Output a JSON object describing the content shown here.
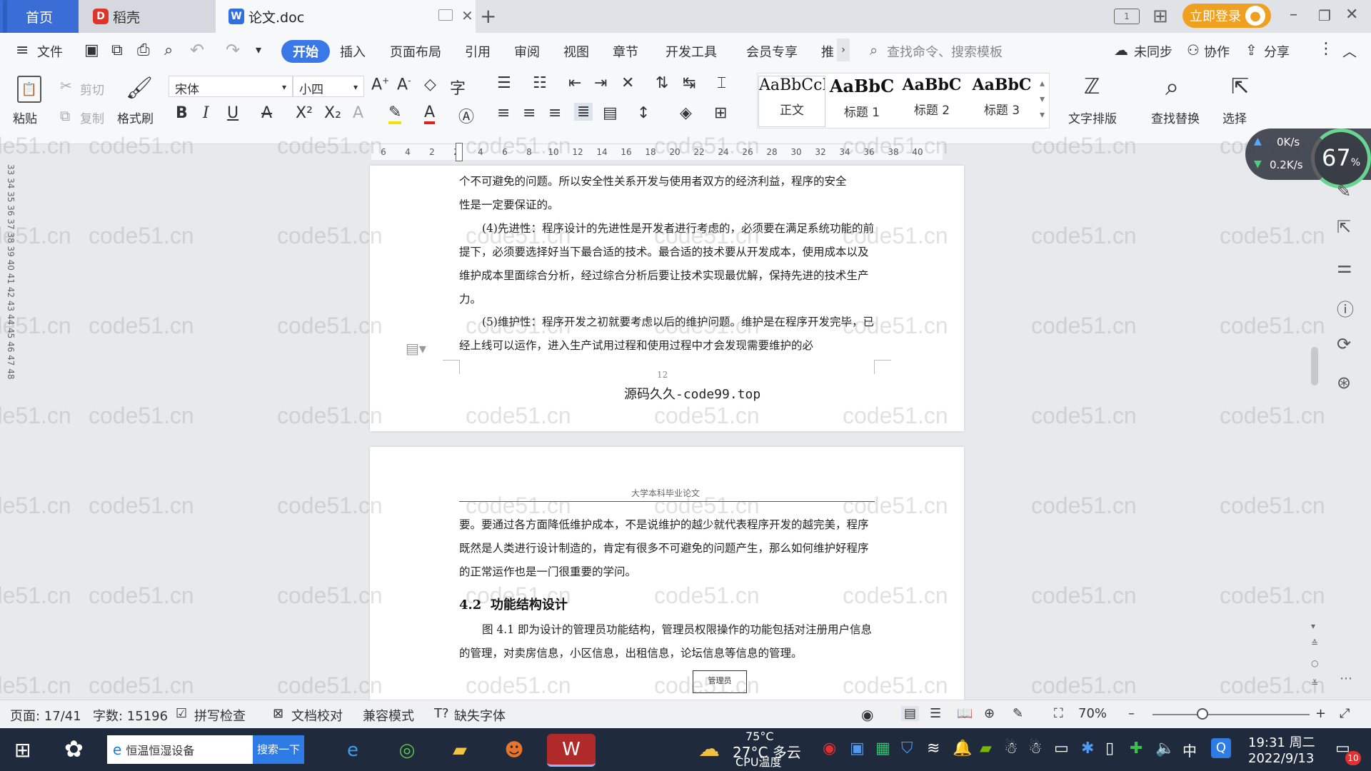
{
  "tabs": {
    "home": "首页",
    "daoke": "稻壳",
    "doc": "论文.doc"
  },
  "titlebar": {
    "login": "立即登录"
  },
  "menu": {
    "file": "文件",
    "start": "开始",
    "insert": "插入",
    "layout": "页面布局",
    "reference": "引用",
    "review": "审阅",
    "view": "视图",
    "chapter": "章节",
    "devtools": "开发工具",
    "member": "会员专享",
    "recommend": "推",
    "search_cmd": "查找命令、搜索模板",
    "unsync": "未同步",
    "collab": "协作",
    "share": "分享"
  },
  "ribbon": {
    "paste": "粘贴",
    "cut": "剪切",
    "copy": "复制",
    "format_painter": "格式刷",
    "font_name": "宋体",
    "font_size": "小四",
    "styles": [
      {
        "sample": "AaBbCcI",
        "label": "正文"
      },
      {
        "sample": "AaBbC",
        "label": "标题 1"
      },
      {
        "sample": "AaBbC",
        "label": "标题 2"
      },
      {
        "sample": "AaBbC",
        "label": "标题 3"
      }
    ],
    "text_layout": "文字排版",
    "find_replace": "查找替换",
    "select": "选择"
  },
  "net_widget": {
    "up": "0K/s",
    "down": "0.2K/s",
    "cpu": "67",
    "cpu_unit": "%"
  },
  "ruler": {
    "marks": [
      "6",
      "4",
      "2",
      "2",
      "4",
      "6",
      "8",
      "10",
      "12",
      "14",
      "16",
      "18",
      "20",
      "22",
      "24",
      "26",
      "28",
      "30",
      "32",
      "34",
      "36",
      "38",
      "40"
    ],
    "vmarks": "33 34 35 36 37 38 39 40 41 42 43 44 45 46 47 48"
  },
  "page1": {
    "lines": [
      "个不可避免的问题。所以安全性关系开发与使用者双方的经济利益，程序的安全",
      "性是一定要保证的。"
    ],
    "para4": "(4)先进性：程序设计的先进性是开发者进行考虑的，必须要在满足系统功能的前提下，必须要选择好当下最合适的技术。最合适的技术要从开发成本，使用成本以及维护成本里面综合分析，经过综合分析后要让技术实现最优解，保持先进的技术生产力。",
    "para5": "(5)维护性：程序开发之初就要考虑以后的维护问题。维护是在程序开发完毕，已经上线可以运作，进入生产试用过程和使用过程中才会发现需要维护的必",
    "page_number": "12",
    "footer": "源码久久-code99.top"
  },
  "page2": {
    "header": "大学本科毕业论文",
    "para1": "要。要通过各方面降低维护成本，不是说维护的越少就代表程序开发的越完美，程序既然是人类进行设计制造的，肯定有很多不可避免的问题产生，那么如何维护好程序的正常运作也是一门很重要的学问。",
    "heading": "4.2  功能结构设计",
    "para2": "图 4.1 即为设计的管理员功能结构，管理员权限操作的功能包括对注册用户信息的管理，对卖房信息，小区信息，出租信息，论坛信息等信息的管理。",
    "diagram_box": "管理员"
  },
  "watermark": "code51.cn",
  "statusbar": {
    "page": "页面: 17/41",
    "words": "字数: 15196",
    "spell": "拼写检查",
    "doc_check": "文档校对",
    "compat": "兼容模式",
    "missing_font": "缺失字体",
    "zoom": "70%"
  },
  "taskbar": {
    "search_text": "恒温恒湿设备",
    "search_button": "搜索一下",
    "weather_temp": "27°C 多云",
    "cpu_temp": "75°C",
    "cpu_label": "CPU温度",
    "ime": "中",
    "time": "19:31 周二",
    "date": "2022/9/13",
    "notif_count": "10"
  }
}
